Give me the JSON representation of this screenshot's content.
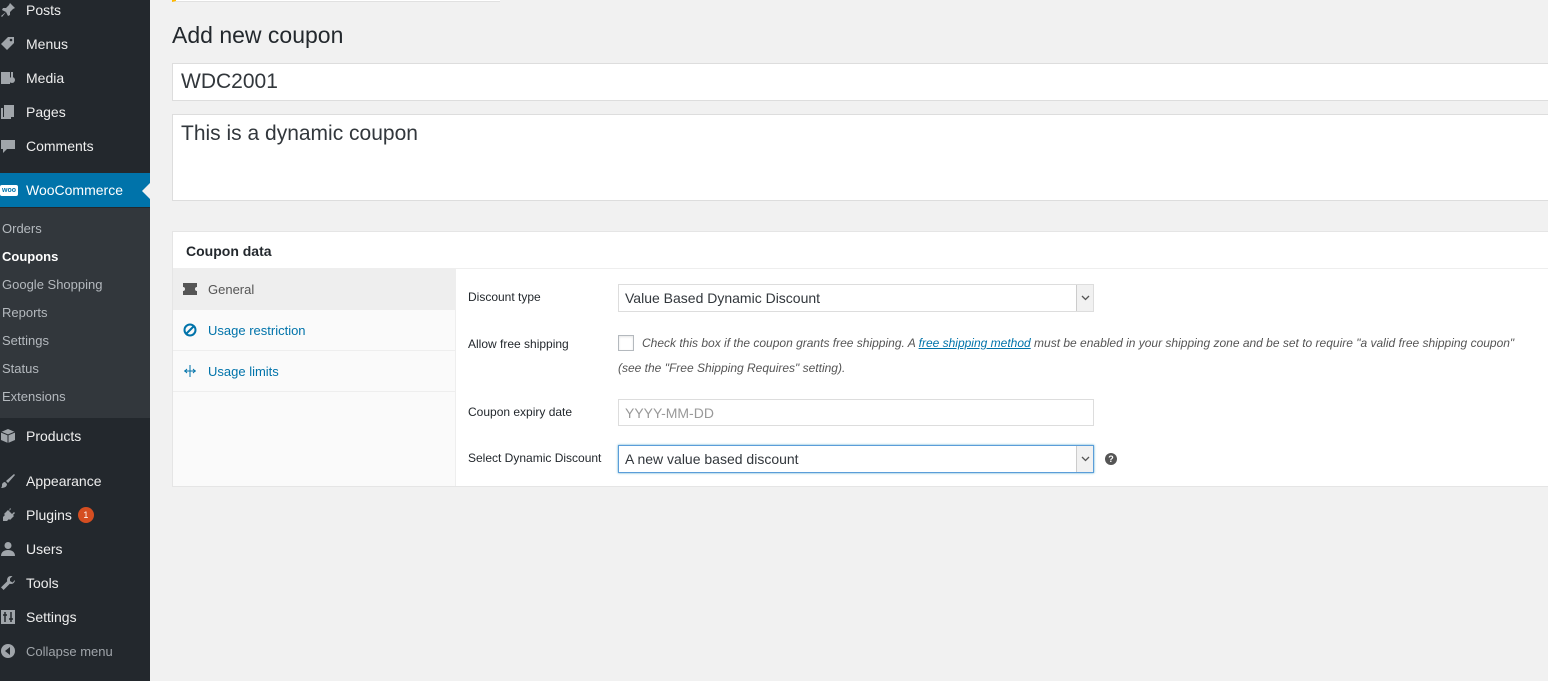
{
  "sidebar": {
    "items": [
      {
        "label": "Posts",
        "icon": "pushpin-icon"
      },
      {
        "label": "Menus",
        "icon": "tag-icon"
      },
      {
        "label": "Media",
        "icon": "media-icon"
      },
      {
        "label": "Pages",
        "icon": "pages-icon"
      },
      {
        "label": "Comments",
        "icon": "comment-icon"
      },
      {
        "label": "WooCommerce",
        "icon": "woo-icon"
      },
      {
        "label": "Products",
        "icon": "box-icon"
      },
      {
        "label": "Appearance",
        "icon": "brush-icon"
      },
      {
        "label": "Plugins",
        "icon": "plugin-icon",
        "badge": "1"
      },
      {
        "label": "Users",
        "icon": "user-icon"
      },
      {
        "label": "Tools",
        "icon": "wrench-icon"
      },
      {
        "label": "Settings",
        "icon": "sliders-icon"
      }
    ],
    "woo_icon_text": "woo",
    "submenu": [
      "Orders",
      "Coupons",
      "Google Shopping",
      "Reports",
      "Settings",
      "Status",
      "Extensions"
    ],
    "collapse_label": "Collapse menu"
  },
  "page": {
    "title": "Add new coupon",
    "coupon_code": "WDC2001",
    "description": "This is a dynamic coupon"
  },
  "coupon_data": {
    "title": "Coupon data",
    "tabs": [
      "General",
      "Usage restriction",
      "Usage limits"
    ],
    "fields": {
      "discount_type_label": "Discount type",
      "discount_type_value": "Value Based Dynamic Discount",
      "free_shipping_label": "Allow free shipping",
      "free_shipping_desc_pre": "Check this box if the coupon grants free shipping. A ",
      "free_shipping_link": "free shipping method",
      "free_shipping_desc_post": " must be enabled in your shipping zone and be set to require \"a valid free shipping coupon\"",
      "free_shipping_desc_line2": "(see the \"Free Shipping Requires\" setting).",
      "expiry_label": "Coupon expiry date",
      "expiry_placeholder": "YYYY-MM-DD",
      "dynamic_label": "Select Dynamic Discount",
      "dynamic_value": "A new value based discount",
      "help_glyph": "?"
    }
  },
  "colors": {
    "sidebar_bg": "#23282d",
    "active_blue": "#0073aa",
    "submenu_bg": "#32373c",
    "badge": "#d54e21"
  }
}
